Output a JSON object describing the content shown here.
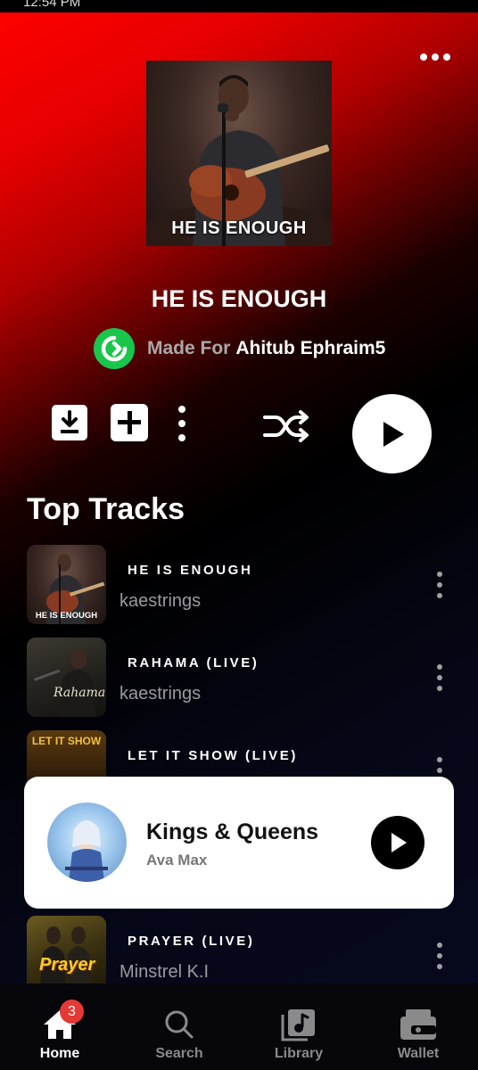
{
  "status": {
    "time": "12:54 PM",
    "icons": "• ⟳ ▮▮▮ ▮▮ ▭"
  },
  "album": {
    "cover_caption": "HE IS ENOUGH",
    "title": "HE IS ENOUGH",
    "made_for_label": "Made For",
    "made_for_user": "Ahitub Ephraim5"
  },
  "section": {
    "title": "Top Tracks"
  },
  "tracks": [
    {
      "title": "HE IS ENOUGH",
      "artist": "kaestrings",
      "thumb_caption": "HE IS ENOUGH"
    },
    {
      "title": "RAHAMA (LIVE)",
      "artist": "kaestrings",
      "thumb_caption": "Rahama"
    },
    {
      "title": "LET IT SHOW (LIVE)",
      "artist": "",
      "thumb_caption": "LET IT SHOW"
    },
    {
      "title": "PRAYER (LIVE)",
      "artist": "Minstrel K.I",
      "thumb_caption": "Prayer"
    }
  ],
  "now_playing": {
    "title": "Kings & Queens",
    "artist": "Ava Max"
  },
  "tabs": [
    {
      "label": "Home",
      "badge": "3"
    },
    {
      "label": "Search"
    },
    {
      "label": "Library"
    },
    {
      "label": "Wallet"
    }
  ],
  "colors": {
    "accent_red": "#ff0000",
    "logo_green": "#19c64b",
    "badge_red": "#e53935"
  }
}
